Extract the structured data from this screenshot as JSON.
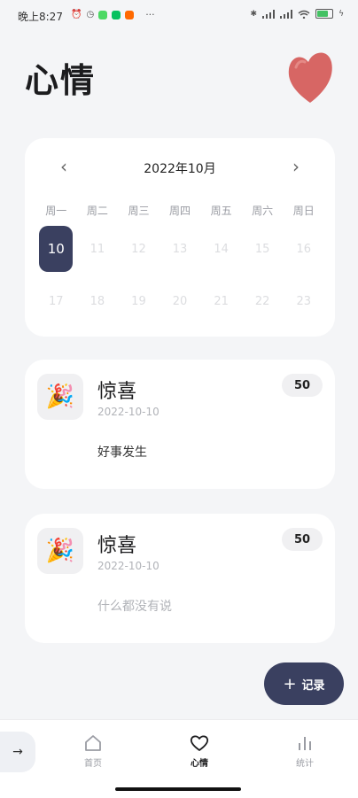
{
  "status_bar": {
    "time": "晚上8:27",
    "more": "···",
    "app_icon_colors": [
      "#4cd964",
      "#07c160",
      "#ff6900"
    ],
    "battery_level": 0.75,
    "battery_color": "#43c163"
  },
  "header": {
    "title": "心情",
    "decoration_icon": "heart-icon",
    "decoration_color": "#d76664"
  },
  "calendar": {
    "month_label": "2022年10月",
    "prev_icon": "chevron-left-icon",
    "next_icon": "chevron-right-icon",
    "weekdays": [
      "周一",
      "周二",
      "周三",
      "周四",
      "周五",
      "周六",
      "周日"
    ],
    "week1": [
      "10",
      "11",
      "12",
      "13",
      "14",
      "15",
      "16"
    ],
    "week2": [
      "17",
      "18",
      "19",
      "20",
      "21",
      "22",
      "23"
    ],
    "selected_day": "10"
  },
  "entries": [
    {
      "mood": "惊喜",
      "date": "2022-10-10",
      "score": "50",
      "note": "好事发生",
      "icon": "party-popper-icon"
    },
    {
      "mood": "惊喜",
      "date": "2022-10-10",
      "score": "50",
      "note": "什么都没有说",
      "icon": "party-popper-icon"
    }
  ],
  "fab": {
    "label": "记录",
    "icon": "plus-icon"
  },
  "bottom_nav": {
    "back_icon": "arrow-right-icon",
    "items": [
      {
        "label": "首页",
        "icon": "home-icon",
        "active": false
      },
      {
        "label": "心情",
        "icon": "heart-outline-icon",
        "active": true
      },
      {
        "label": "统计",
        "icon": "bar-chart-icon",
        "active": false
      }
    ]
  },
  "colors": {
    "accent": "#3a4060",
    "background": "#f4f5f7",
    "card": "#ffffff",
    "muted_text": "#b1b3b8",
    "inactive_day": "#dcdde0"
  }
}
